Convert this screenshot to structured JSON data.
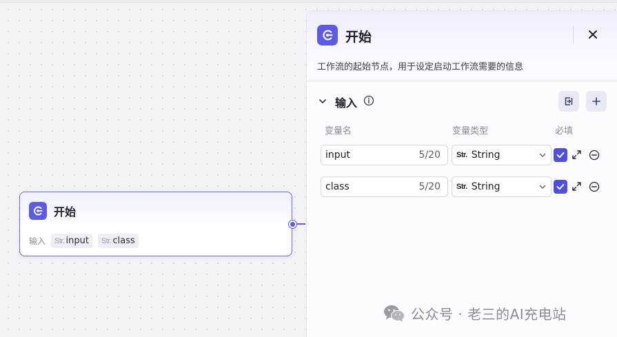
{
  "node": {
    "title": "开始",
    "input_label": "输入",
    "tags": [
      {
        "type": "Str.",
        "name": "input"
      },
      {
        "type": "Str.",
        "name": "class"
      }
    ]
  },
  "panel": {
    "title": "开始",
    "description": "工作流的起始节点，用于设定启动工作流需要的信息",
    "section_title": "输入",
    "columns": {
      "name": "变量名",
      "type": "变量类型",
      "required": "必填"
    },
    "rows": [
      {
        "name": "input",
        "count": "5/20",
        "type_prefix": "Str.",
        "type": "String",
        "required": true
      },
      {
        "name": "class",
        "count": "5/20",
        "type_prefix": "Str.",
        "type": "String",
        "required": true
      }
    ]
  },
  "watermark": {
    "text": "公众号 · 老三的AI充电站",
    "icon": "wechat-icon"
  },
  "colors": {
    "accent": "#5c5be6",
    "checkbox": "#4e4ee0"
  }
}
